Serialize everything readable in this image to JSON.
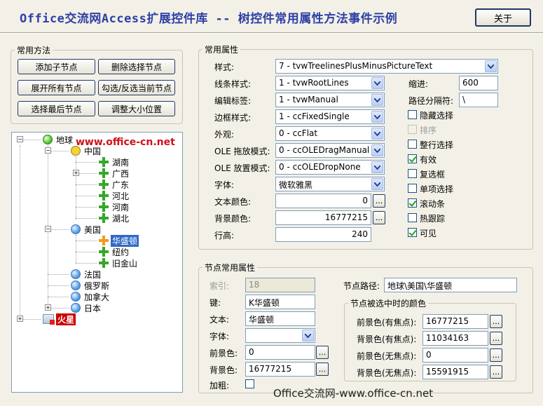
{
  "header": {
    "title": "Office交流网Access扩展控件库 -- 树控件常用属性方法事件示例",
    "close_label": "关于"
  },
  "methods": {
    "legend": "常用方法",
    "buttons": [
      "添加子节点",
      "删除选择节点",
      "展开所有节点",
      "勾选/反选当前节点",
      "选择最后节点",
      "调整大小位置"
    ]
  },
  "tree": {
    "watermark": "www.office-cn.net",
    "nodes": [
      "地球",
      "中国",
      "湖南",
      "广西",
      "广东",
      "河北",
      "河南",
      "湖北",
      "美国",
      "华盛顿",
      "纽约",
      "旧金山",
      "法国",
      "俄罗斯",
      "加拿大",
      "日本",
      "火星"
    ],
    "selected": "华盛顿"
  },
  "props": {
    "legend": "常用属性",
    "style_label": "样式:",
    "style_value": "7 - tvwTreelinesPlusMinusPictureText",
    "linestyle_label": "线条样式:",
    "linestyle_value": "1 - tvwRootLines",
    "labeledit_label": "编辑标签:",
    "labeledit_value": "1 - tvwManual",
    "border_label": "边框样式:",
    "border_value": "1 - ccFixedSingle",
    "appearance_label": "外观:",
    "appearance_value": "0 - ccFlat",
    "oledrag_label": "OLE 拖放模式:",
    "oledrag_value": "0 - ccOLEDragManual",
    "oledrop_label": "OLE 放置模式:",
    "oledrop_value": "0 - ccOLEDropNone",
    "font_label": "字体:",
    "font_value": "微软雅黑",
    "forecolor_label": "文本颜色:",
    "forecolor_value": "0",
    "backcolor_label": "背景颜色:",
    "backcolor_value": "16777215",
    "lineheight_label": "行高:",
    "lineheight_value": "240",
    "indent_label": "缩进:",
    "indent_value": "600",
    "pathsep_label": "路径分隔符:",
    "pathsep_value": "\\",
    "checks": [
      {
        "label": "隐藏选择",
        "checked": false,
        "disabled": false
      },
      {
        "label": "排序",
        "checked": false,
        "disabled": true
      },
      {
        "label": "整行选择",
        "checked": false,
        "disabled": false
      },
      {
        "label": "有效",
        "checked": true,
        "disabled": false
      },
      {
        "label": "复选框",
        "checked": false,
        "disabled": false
      },
      {
        "label": "单项选择",
        "checked": false,
        "disabled": false
      },
      {
        "label": "滚动条",
        "checked": true,
        "disabled": false
      },
      {
        "label": "热跟踪",
        "checked": false,
        "disabled": false
      },
      {
        "label": "可见",
        "checked": true,
        "disabled": false
      }
    ]
  },
  "node": {
    "legend": "节点常用属性",
    "index_label": "索引:",
    "index_value": "18",
    "key_label": "键:",
    "key_value": "K华盛顿",
    "text_label": "文本:",
    "text_value": "华盛顿",
    "font_label": "字体:",
    "font_value": "",
    "fore_label": "前景色:",
    "fore_value": "0",
    "back_label": "背景色:",
    "back_value": "16777215",
    "bold_label": "加粗:",
    "bold_checked": false,
    "path_label": "节点路径:",
    "path_value": "地球\\美国\\华盛顿",
    "selcolor_legend": "节点被选中时的颜色",
    "selfore_focus_label": "前景色(有焦点):",
    "selfore_focus_value": "16777215",
    "selback_focus_label": "背景色(有焦点):",
    "selback_focus_value": "11034163",
    "selfore_nofocus_label": "前景色(无焦点):",
    "selfore_nofocus_value": "0",
    "selback_nofocus_label": "背景色(无焦点):",
    "selback_nofocus_value": "15591915"
  },
  "footer": "Office交流网-www.office-cn.net",
  "colors": {
    "title": "#2e3fa8",
    "selection": "#316ac5",
    "watermark": "#d0101d"
  },
  "icons": {
    "dropdown": "chevron-down-icon",
    "ellipsis": "ellipsis-button",
    "globe": "globe-icon",
    "node_plus": "plus-icon"
  }
}
